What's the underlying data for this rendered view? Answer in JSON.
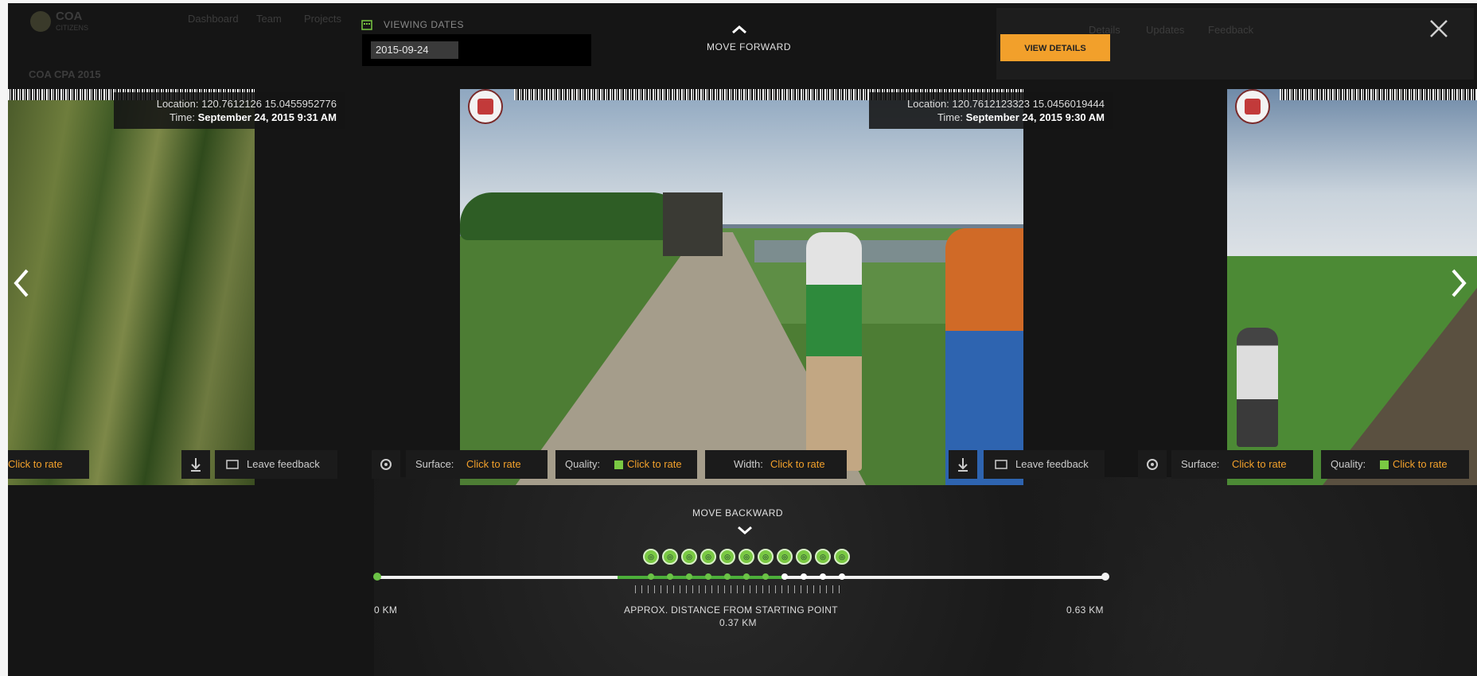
{
  "background": {
    "brand": "COA",
    "brand_sub": "CITIZENS",
    "nav": [
      "Dashboard",
      "Team",
      "Projects"
    ],
    "section_title": "COA CPA 2015",
    "panel_tabs": [
      "Details",
      "Updates",
      "Feedback"
    ]
  },
  "viewer": {
    "viewing_dates_label": "VIEWING DATES",
    "selected_date": "2015-09-24",
    "move_forward": "MOVE FORWARD",
    "move_backward": "MOVE BACKWARD",
    "details_button": "VIEW DETAILS",
    "close_icon": "close-icon"
  },
  "photos": {
    "left": {
      "location": "Location: 120.7612126 15.0455952776",
      "time_label": "Time:",
      "time_value": "September 24, 2015 9:31 AM",
      "toolbar_partial": "Click to rate",
      "download_icon": "download-icon",
      "feedback_label": "Leave feedback"
    },
    "center": {
      "location": "Location: 120.7612123323 15.0456019444",
      "time_label": "Time:",
      "time_value": "September 24, 2015 9:30 AM",
      "surface_label": "Surface:",
      "surface_value": "Click to rate",
      "quality_label": "Quality:",
      "quality_value": "Click to rate",
      "width_label": "Width:",
      "width_value": "Click to rate",
      "download_icon": "download-icon",
      "feedback_label": "Leave feedback"
    },
    "right": {
      "surface_label": "Surface:",
      "surface_value": "Click to rate",
      "quality_label": "Quality:",
      "quality_value": "Click to rate"
    }
  },
  "timeline": {
    "start_label": "0 KM",
    "middle_label": "APPROX. DISTANCE FROM STARTING POINT",
    "middle_value": "0.37 KM",
    "end_label": "0.63 KM",
    "colors": {
      "track": "#f2f2f2",
      "progress": "#4caf3a",
      "accent": "#f2a02b"
    }
  }
}
